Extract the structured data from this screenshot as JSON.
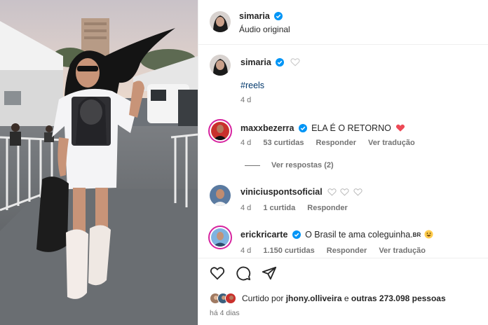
{
  "header": {
    "username": "simaria",
    "audio": "Áudio original"
  },
  "caption": {
    "username": "simaria",
    "hashtag": "#reels",
    "time": "4 d"
  },
  "comments": [
    {
      "username": "maxxbezerra",
      "text": "ELA É O RETORNO",
      "time": "4 d",
      "likes": "53 curtidas",
      "reply": "Responder",
      "translate": "Ver tradução",
      "view_replies": "Ver respostas (2)"
    },
    {
      "username": "viniciuspontsoficial",
      "time": "4 d",
      "likes": "1 curtida",
      "reply": "Responder"
    },
    {
      "username": "erickricarte",
      "text": "O Brasil te ama coleguinha.",
      "text_suffix": "BR",
      "time": "4 d",
      "likes": "1.150 curtidas",
      "reply": "Responder",
      "translate": "Ver tradução"
    }
  ],
  "footer": {
    "liked_prefix": "Curtido por",
    "liked_user": "jhony.olliveira",
    "liked_middle": "e",
    "liked_others": "outras 273.098 pessoas",
    "time_ago": "há 4 dias"
  },
  "colors": {
    "accent_blue": "#0095f6",
    "heart_red": "#ed4956",
    "link_blue": "#00376b"
  },
  "icons": [
    "verified-icon",
    "heart-icon",
    "comment-icon",
    "share-icon",
    "smile-emoji-icon"
  ]
}
